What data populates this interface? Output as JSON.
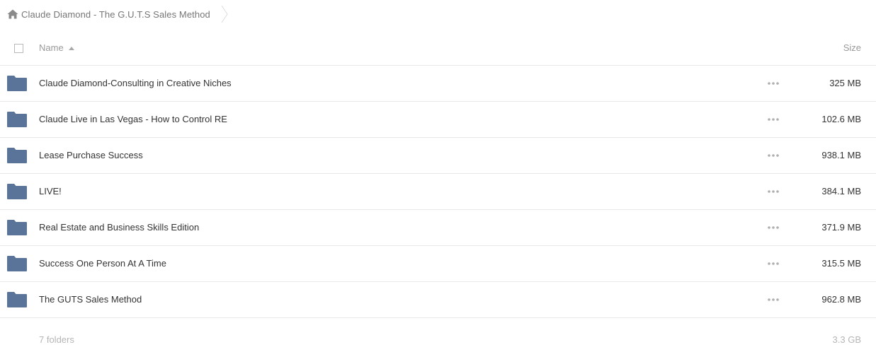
{
  "breadcrumb": {
    "home_icon": "home-icon",
    "current": "Claude Diamond - The G.U.T.S Sales Method"
  },
  "header": {
    "name_label": "Name",
    "size_label": "Size",
    "sort_direction": "ascending"
  },
  "colors": {
    "folder": "#5a7399",
    "divider": "#e8e8e8",
    "muted_text": "#999999"
  },
  "rows": [
    {
      "name": "Claude Diamond-Consulting in Creative Niches",
      "size": "325 MB",
      "icon": "folder-icon"
    },
    {
      "name": "Claude Live in Las Vegas - How to Control RE",
      "size": "102.6 MB",
      "icon": "folder-icon"
    },
    {
      "name": "Lease Purchase Success",
      "size": "938.1 MB",
      "icon": "folder-icon"
    },
    {
      "name": "LIVE!",
      "size": "384.1 MB",
      "icon": "folder-icon"
    },
    {
      "name": "Real Estate and Business Skills Edition",
      "size": "371.9 MB",
      "icon": "folder-icon"
    },
    {
      "name": "Success One Person At A Time",
      "size": "315.5 MB",
      "icon": "folder-icon"
    },
    {
      "name": "The GUTS Sales Method",
      "size": "962.8 MB",
      "icon": "folder-icon"
    }
  ],
  "footer": {
    "count": "7 folders",
    "total_size": "3.3 GB"
  }
}
